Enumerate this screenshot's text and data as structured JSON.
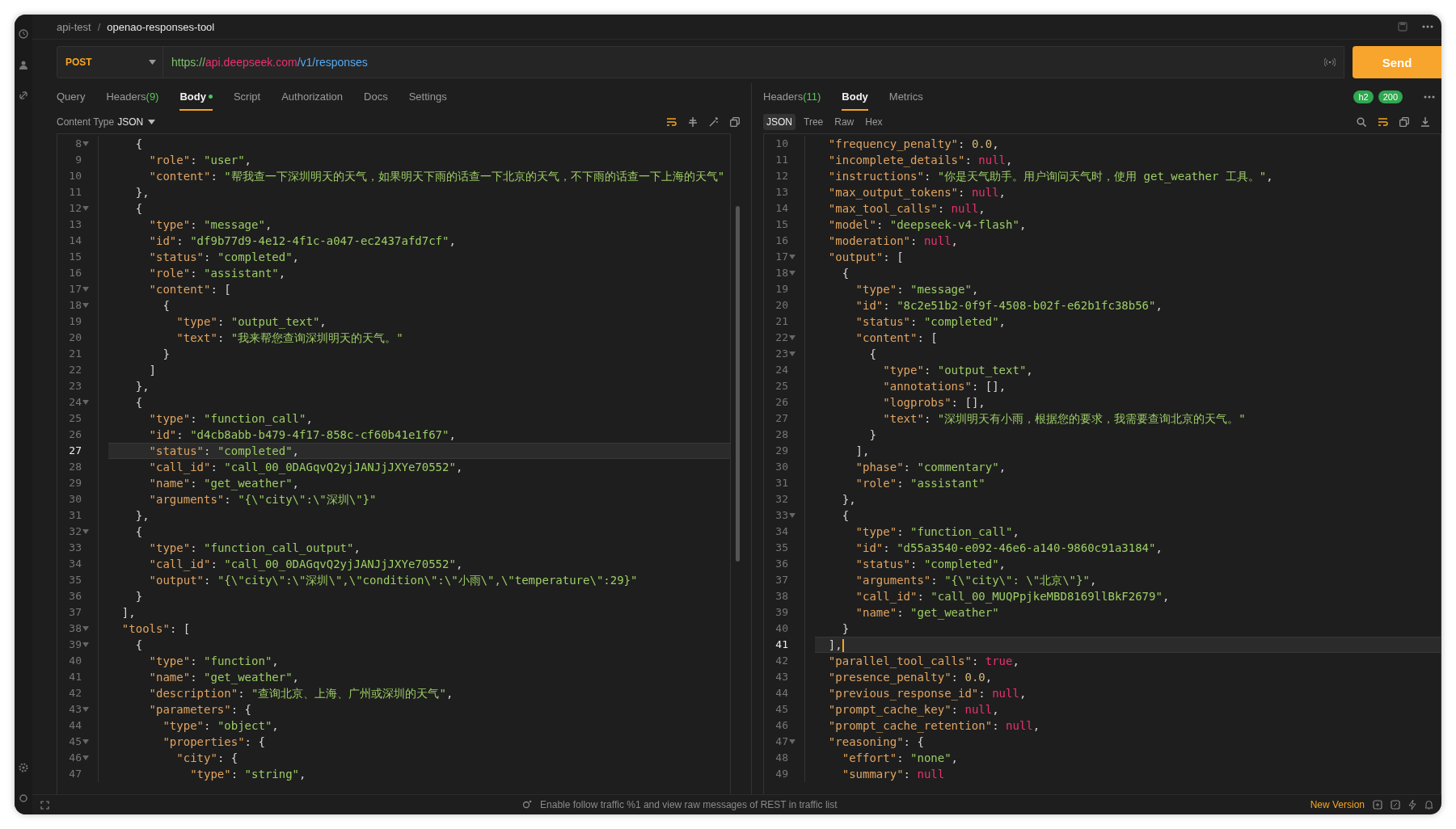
{
  "breadcrumb": [
    {
      "label": "api-test",
      "selected": false
    },
    {
      "separator": "/"
    },
    {
      "label": "openao-responses-tool",
      "selected": true
    }
  ],
  "request": {
    "method": "POST",
    "url": [
      {
        "text": "https://",
        "kind": "scheme"
      },
      {
        "text": "api.deepseek.com",
        "kind": "host"
      },
      {
        "text": "/v1/responses",
        "kind": "path"
      }
    ],
    "send": "Send"
  },
  "request_tabs": [
    {
      "label": "Query",
      "dot": false,
      "selected": false
    },
    {
      "label": "Headers",
      "count": "(9)",
      "dot": false,
      "selected": false
    },
    {
      "label": "Body",
      "dot": true,
      "selected": true
    },
    {
      "label": "Script",
      "dot": false,
      "selected": false
    },
    {
      "label": "Authorization",
      "dot": false,
      "selected": false
    },
    {
      "label": "Docs",
      "dot": false,
      "selected": false
    },
    {
      "label": "Settings",
      "dot": false,
      "selected": false
    }
  ],
  "content_type": {
    "label": "Content Type",
    "value": "JSON"
  },
  "request_body": {
    "focused": false,
    "lines": [
      {
        "n": "8",
        "text": "    {",
        "fold": true,
        "current": false
      },
      {
        "n": "9",
        "text": "      \"role\": \"user\",",
        "fold": false,
        "current": false
      },
      {
        "n": "10",
        "text": "      \"content\": \"帮我查一下深圳明天的天气，如果明天下雨的话查一下北京的天气，不下雨的话查一下上海的天气\"",
        "fold": false,
        "current": false
      },
      {
        "n": "11",
        "text": "    },",
        "fold": false,
        "current": false
      },
      {
        "n": "12",
        "text": "    {",
        "fold": true,
        "current": false
      },
      {
        "n": "13",
        "text": "      \"type\": \"message\",",
        "fold": false,
        "current": false
      },
      {
        "n": "14",
        "text": "      \"id\": \"df9b77d9-4e12-4f1c-a047-ec2437afd7cf\",",
        "fold": false,
        "current": false
      },
      {
        "n": "15",
        "text": "      \"status\": \"completed\",",
        "fold": false,
        "current": false
      },
      {
        "n": "16",
        "text": "      \"role\": \"assistant\",",
        "fold": false,
        "current": false
      },
      {
        "n": "17",
        "text": "      \"content\": [",
        "fold": true,
        "current": false
      },
      {
        "n": "18",
        "text": "        {",
        "fold": true,
        "current": false
      },
      {
        "n": "19",
        "text": "          \"type\": \"output_text\",",
        "fold": false,
        "current": false
      },
      {
        "n": "20",
        "text": "          \"text\": \"我来帮您查询深圳明天的天气。\"",
        "fold": false,
        "current": false
      },
      {
        "n": "21",
        "text": "        }",
        "fold": false,
        "current": false
      },
      {
        "n": "22",
        "text": "      ]",
        "fold": false,
        "current": false
      },
      {
        "n": "23",
        "text": "    },",
        "fold": false,
        "current": false
      },
      {
        "n": "24",
        "text": "    {",
        "fold": true,
        "current": false
      },
      {
        "n": "25",
        "text": "      \"type\": \"function_call\",",
        "fold": false,
        "current": false
      },
      {
        "n": "26",
        "text": "      \"id\": \"d4cb8abb-b479-4f17-858c-cf60b41e1f67\",",
        "fold": false,
        "current": false
      },
      {
        "n": "27",
        "text": "      \"status\": \"completed\",",
        "fold": false,
        "current": true
      },
      {
        "n": "28",
        "text": "      \"call_id\": \"call_00_0DAGqvQ2yjJANJjJXYe70552\",",
        "fold": false,
        "current": false
      },
      {
        "n": "29",
        "text": "      \"name\": \"get_weather\",",
        "fold": false,
        "current": false
      },
      {
        "n": "30",
        "text": "      \"arguments\": \"{\\\"city\\\":\\\"深圳\\\"}\"",
        "fold": false,
        "current": false
      },
      {
        "n": "31",
        "text": "    },",
        "fold": false,
        "current": false
      },
      {
        "n": "32",
        "text": "    {",
        "fold": true,
        "current": false
      },
      {
        "n": "33",
        "text": "      \"type\": \"function_call_output\",",
        "fold": false,
        "current": false
      },
      {
        "n": "34",
        "text": "      \"call_id\": \"call_00_0DAGqvQ2yjJANJjJXYe70552\",",
        "fold": false,
        "current": false
      },
      {
        "n": "35",
        "text": "      \"output\": \"{\\\"city\\\":\\\"深圳\\\",\\\"condition\\\":\\\"小雨\\\",\\\"temperature\\\":29}\"",
        "fold": false,
        "current": false
      },
      {
        "n": "36",
        "text": "    }",
        "fold": false,
        "current": false
      },
      {
        "n": "37",
        "text": "  ],",
        "fold": false,
        "current": false
      },
      {
        "n": "38",
        "text": "  \"tools\": [",
        "fold": true,
        "current": false
      },
      {
        "n": "39",
        "text": "    {",
        "fold": true,
        "current": false
      },
      {
        "n": "40",
        "text": "      \"type\": \"function\",",
        "fold": false,
        "current": false
      },
      {
        "n": "41",
        "text": "      \"name\": \"get_weather\",",
        "fold": false,
        "current": false
      },
      {
        "n": "42",
        "text": "      \"description\": \"查询北京、上海、广州或深圳的天气\",",
        "fold": false,
        "current": false
      },
      {
        "n": "43",
        "text": "      \"parameters\": {",
        "fold": true,
        "current": false
      },
      {
        "n": "44",
        "text": "        \"type\": \"object\",",
        "fold": false,
        "current": false
      },
      {
        "n": "45",
        "text": "        \"properties\": {",
        "fold": true,
        "current": false
      },
      {
        "n": "46",
        "text": "          \"city\": {",
        "fold": true,
        "current": false
      },
      {
        "n": "47",
        "text": "            \"type\": \"string\",",
        "fold": false,
        "current": false
      }
    ]
  },
  "response_tabs": [
    {
      "label": "Headers",
      "count": "(11)",
      "selected": false
    },
    {
      "label": "Body",
      "selected": true
    },
    {
      "label": "Metrics",
      "selected": false
    }
  ],
  "badges": [
    {
      "text": "h2"
    },
    {
      "text": "200"
    }
  ],
  "view_tabs": [
    {
      "label": "JSON",
      "selected": true
    },
    {
      "label": "Tree",
      "selected": false
    },
    {
      "label": "Raw",
      "selected": false
    },
    {
      "label": "Hex",
      "selected": false
    }
  ],
  "response_body": {
    "focused": true,
    "lines": [
      {
        "n": "10",
        "text": "  \"frequency_penalty\": 0.0,",
        "fold": false,
        "current": false
      },
      {
        "n": "11",
        "text": "  \"incomplete_details\": null,",
        "fold": false,
        "current": false
      },
      {
        "n": "12",
        "text": "  \"instructions\": \"你是天气助手。用户询问天气时，使用 get_weather 工具。\",",
        "fold": false,
        "current": false
      },
      {
        "n": "13",
        "text": "  \"max_output_tokens\": null,",
        "fold": false,
        "current": false
      },
      {
        "n": "14",
        "text": "  \"max_tool_calls\": null,",
        "fold": false,
        "current": false
      },
      {
        "n": "15",
        "text": "  \"model\": \"deepseek-v4-flash\",",
        "fold": false,
        "current": false
      },
      {
        "n": "16",
        "text": "  \"moderation\": null,",
        "fold": false,
        "current": false
      },
      {
        "n": "17",
        "text": "  \"output\": [",
        "fold": true,
        "current": false
      },
      {
        "n": "18",
        "text": "    {",
        "fold": true,
        "current": false
      },
      {
        "n": "19",
        "text": "      \"type\": \"message\",",
        "fold": false,
        "current": false
      },
      {
        "n": "20",
        "text": "      \"id\": \"8c2e51b2-0f9f-4508-b02f-e62b1fc38b56\",",
        "fold": false,
        "current": false
      },
      {
        "n": "21",
        "text": "      \"status\": \"completed\",",
        "fold": false,
        "current": false
      },
      {
        "n": "22",
        "text": "      \"content\": [",
        "fold": true,
        "current": false
      },
      {
        "n": "23",
        "text": "        {",
        "fold": true,
        "current": false
      },
      {
        "n": "24",
        "text": "          \"type\": \"output_text\",",
        "fold": false,
        "current": false
      },
      {
        "n": "25",
        "text": "          \"annotations\": [],",
        "fold": false,
        "current": false
      },
      {
        "n": "26",
        "text": "          \"logprobs\": [],",
        "fold": false,
        "current": false
      },
      {
        "n": "27",
        "text": "          \"text\": \"深圳明天有小雨，根据您的要求，我需要查询北京的天气。\"",
        "fold": false,
        "current": false
      },
      {
        "n": "28",
        "text": "        }",
        "fold": false,
        "current": false
      },
      {
        "n": "29",
        "text": "      ],",
        "fold": false,
        "current": false
      },
      {
        "n": "30",
        "text": "      \"phase\": \"commentary\",",
        "fold": false,
        "current": false
      },
      {
        "n": "31",
        "text": "      \"role\": \"assistant\"",
        "fold": false,
        "current": false
      },
      {
        "n": "32",
        "text": "    },",
        "fold": false,
        "current": false
      },
      {
        "n": "33",
        "text": "    {",
        "fold": true,
        "current": false
      },
      {
        "n": "34",
        "text": "      \"type\": \"function_call\",",
        "fold": false,
        "current": false
      },
      {
        "n": "35",
        "text": "      \"id\": \"d55a3540-e092-46e6-a140-9860c91a3184\",",
        "fold": false,
        "current": false
      },
      {
        "n": "36",
        "text": "      \"status\": \"completed\",",
        "fold": false,
        "current": false
      },
      {
        "n": "37",
        "text": "      \"arguments\": \"{\\\"city\\\": \\\"北京\\\"}\",",
        "fold": false,
        "current": false
      },
      {
        "n": "38",
        "text": "      \"call_id\": \"call_00_MUQPpjkeMBD8169llBkF2679\",",
        "fold": false,
        "current": false
      },
      {
        "n": "39",
        "text": "      \"name\": \"get_weather\"",
        "fold": false,
        "current": false
      },
      {
        "n": "40",
        "text": "    }",
        "fold": false,
        "current": false
      },
      {
        "n": "41",
        "text": "  ],",
        "fold": false,
        "current": true
      },
      {
        "n": "42",
        "text": "  \"parallel_tool_calls\": true,",
        "fold": false,
        "current": false
      },
      {
        "n": "43",
        "text": "  \"presence_penalty\": 0.0,",
        "fold": false,
        "current": false
      },
      {
        "n": "44",
        "text": "  \"previous_response_id\": null,",
        "fold": false,
        "current": false
      },
      {
        "n": "45",
        "text": "  \"prompt_cache_key\": null,",
        "fold": false,
        "current": false
      },
      {
        "n": "46",
        "text": "  \"prompt_cache_retention\": null,",
        "fold": false,
        "current": false
      },
      {
        "n": "47",
        "text": "  \"reasoning\": {",
        "fold": true,
        "current": false
      },
      {
        "n": "48",
        "text": "    \"effort\": \"none\",",
        "fold": false,
        "current": false
      },
      {
        "n": "49",
        "text": "    \"summary\": null",
        "fold": false,
        "current": false
      }
    ]
  },
  "status_bar": {
    "hint": "Enable follow traffic %1 and view raw messages of REST in traffic list",
    "update": "New Version"
  }
}
